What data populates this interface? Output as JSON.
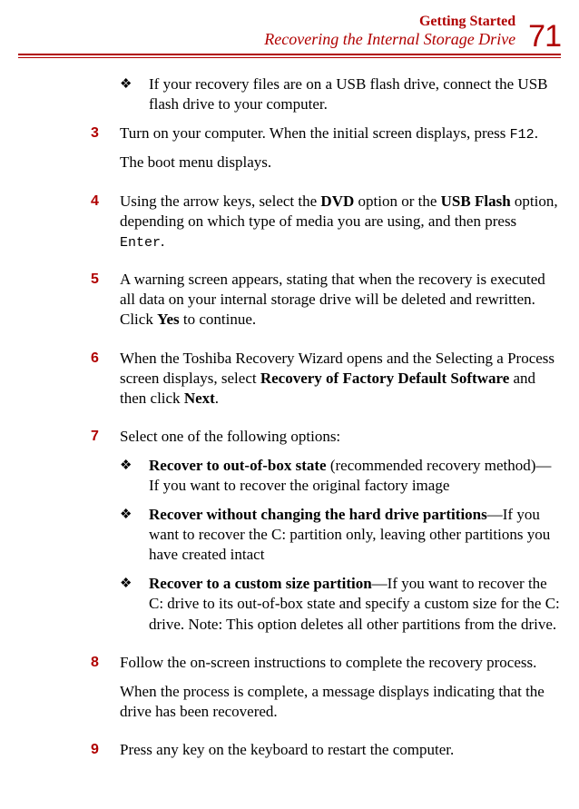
{
  "header": {
    "chapter": "Getting Started",
    "section": "Recovering the Internal Storage Drive",
    "page_number": "71"
  },
  "body": {
    "pre_bullet": "If your recovery files are on a USB flash drive, connect the USB flash drive to your computer.",
    "step3": {
      "num": "3",
      "t1": "Turn on your computer. When the initial screen displays, press ",
      "key": "F12",
      "t2": ".",
      "p2": "The boot menu displays."
    },
    "step4": {
      "num": "4",
      "t1": "Using the arrow keys, select the ",
      "b1": "DVD",
      "t2": " option or the ",
      "b2": "USB Flash",
      "t3": " option, depending on which type of media you are using, and then press ",
      "key": "Enter",
      "t4": "."
    },
    "step5": {
      "num": "5",
      "t1": "A warning screen appears, stating that when the recovery is executed all data on your internal storage drive will be deleted and rewritten. Click ",
      "b1": "Yes",
      "t2": " to continue."
    },
    "step6": {
      "num": "6",
      "t1": "When the Toshiba Recovery Wizard opens and the Selecting a Process screen displays, select ",
      "b1": "Recovery of Factory Default Software",
      "t2": " and then click ",
      "b2": "Next",
      "t3": "."
    },
    "step7": {
      "num": "7",
      "t1": "Select one of the following options:",
      "opt1": {
        "b": "Recover to out-of-box state",
        "t": " (recommended recovery method)—If you want to recover the original factory image"
      },
      "opt2": {
        "b": "Recover without changing the hard drive partitions",
        "t": "—If you want to recover the C: partition only, leaving other partitions you have created intact"
      },
      "opt3": {
        "b": "Recover to a custom size partition",
        "t": "—If you want to recover the C: drive to its out-of-box state and specify a custom size for the C: drive. Note: This option deletes all other partitions from the drive."
      }
    },
    "step8": {
      "num": "8",
      "t1": "Follow the on-screen instructions to complete the recovery process.",
      "p2": "When the process is complete, a message displays indicating that the drive has been recovered."
    },
    "step9": {
      "num": "9",
      "t1": "Press any key on the keyboard to restart the computer."
    }
  },
  "glyphs": {
    "diamond": "❖"
  }
}
